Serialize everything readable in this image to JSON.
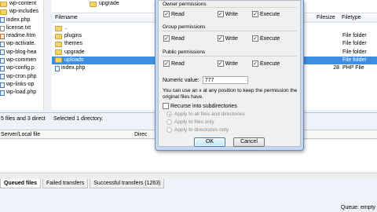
{
  "local": {
    "files": [
      {
        "name": "wp-content",
        "kind": "folder"
      },
      {
        "name": "wp-includes",
        "kind": "folder"
      },
      {
        "name": "index.php",
        "kind": "php"
      },
      {
        "name": "license.txt",
        "kind": "txt"
      },
      {
        "name": "readme.htm",
        "kind": "htm"
      },
      {
        "name": "wp-activate.",
        "kind": "php"
      },
      {
        "name": "wp-blog-hea",
        "kind": "php"
      },
      {
        "name": "wp-commen",
        "kind": "php"
      },
      {
        "name": "wp-config.p",
        "kind": "php"
      },
      {
        "name": "wp-cron.php",
        "kind": "php"
      },
      {
        "name": "wp-links-op",
        "kind": "php"
      },
      {
        "name": "wp-load.php",
        "kind": "php"
      }
    ],
    "status": "5 files and 3 direct"
  },
  "remote": {
    "current_folder": "upgrade",
    "columns": {
      "filename": "Filename",
      "filesize": "Filesize",
      "filetype": "Filetype"
    },
    "files": [
      {
        "name": "..",
        "size": "",
        "type": "",
        "kind": "folder"
      },
      {
        "name": "plugins",
        "size": "",
        "type": "File folder",
        "kind": "folder"
      },
      {
        "name": "themes",
        "size": "",
        "type": "File folder",
        "kind": "folder"
      },
      {
        "name": "upgrade",
        "size": "",
        "type": "File folder",
        "kind": "folder"
      },
      {
        "name": "uploads",
        "size": "",
        "type": "File folder",
        "kind": "folder",
        "selected": true
      },
      {
        "name": "index.php",
        "size": "28",
        "type": "PHP File",
        "kind": "php"
      }
    ],
    "status": "Selected 1 directory."
  },
  "queue": {
    "columns": {
      "server_local": "Server/Local file",
      "direction": "Direc"
    },
    "tabs": [
      "Queued files",
      "Failed transfers",
      "Successful transfers (1263)"
    ],
    "status": "Queue: empty"
  },
  "dialog": {
    "owner_label": "Owner permissions",
    "group_label": "Group permissions",
    "public_label": "Public permissions",
    "perm_labels": {
      "read": "Read",
      "write": "Write",
      "execute": "Execute"
    },
    "numeric_label": "Numeric value:",
    "numeric_value": "777",
    "help_text": "You can use an x at any position to keep the permission the original files have.",
    "recurse_label": "Recurse into subdirectories",
    "apply_options": [
      "Apply to all files and directories",
      "Apply to files only",
      "Apply to directories only"
    ],
    "ok_label": "OK",
    "cancel_label": "Cancel"
  },
  "colors": {
    "selection": "#3d8ee2",
    "dialog_frame": "#c6d7ef"
  }
}
